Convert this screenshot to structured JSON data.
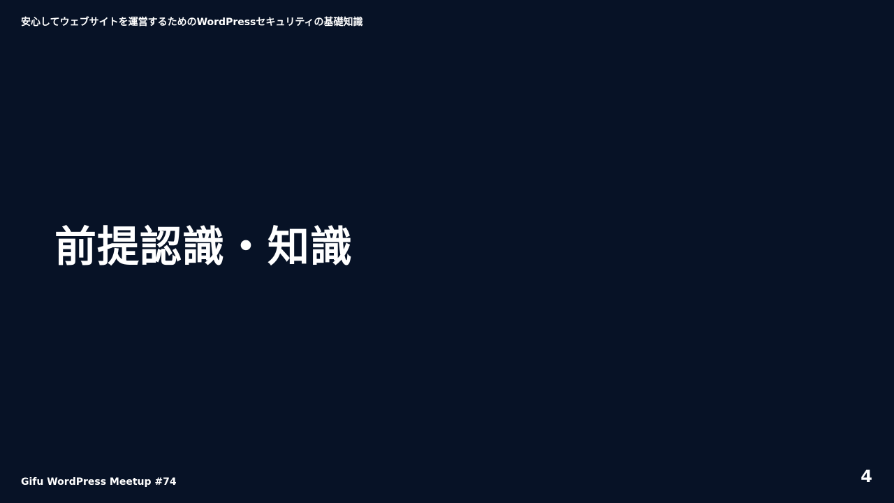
{
  "slide": {
    "deck_title": "安心してウェブサイトを運営するためのWordPressセキュリティの基礎知識",
    "section_heading": "前提認識・知識",
    "footer": {
      "event_name": "Gifu WordPress Meetup #74",
      "page_number": "4"
    },
    "colors": {
      "background": "#071226",
      "text": "#ffffff"
    }
  }
}
